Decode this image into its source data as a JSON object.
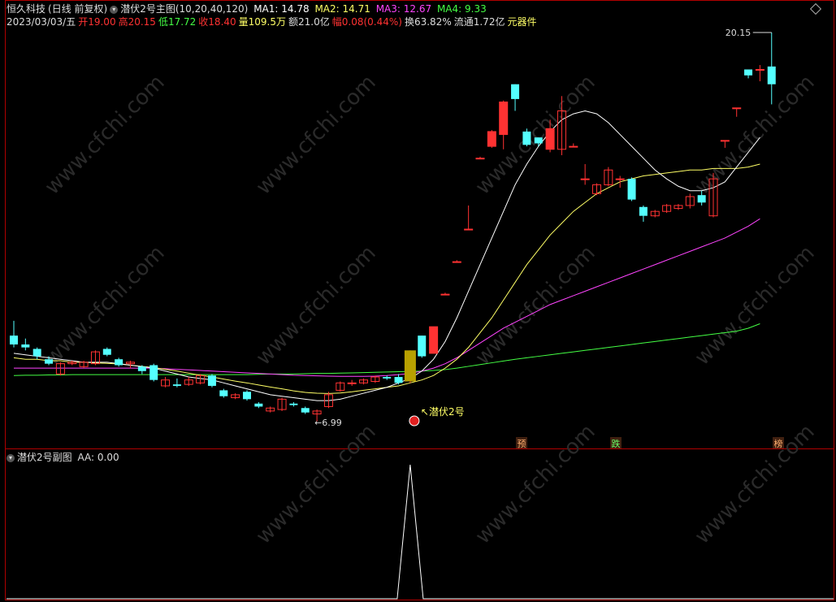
{
  "header": {
    "stock_name": "恒久科技",
    "period": "(日线 前复权)",
    "indicator_name": "潜伏2号主图",
    "params": "(10,20,40,120)",
    "ma1": "MA1: 14.78",
    "ma2": "MA2: 14.71",
    "ma3": "MA3: 12.67",
    "ma4": "MA4: 9.33"
  },
  "quote": {
    "date": "2023/03/03/五",
    "open": "开19.00",
    "high": "高20.15",
    "low": "低17.72",
    "close": "收18.40",
    "volume": "量109.5万",
    "amount": "额21.0亿",
    "change": "幅0.08(0.44%)",
    "turnover": "换63.82%",
    "float": "流通1.72亿",
    "sector": "元器件"
  },
  "sub": {
    "title": "潜伏2号副图",
    "aa": "AA: 0.00"
  },
  "annotations": {
    "max_price": "20.15",
    "min_price": "6.99",
    "signal_label": "潜伏2号",
    "tag_yu": "预",
    "tag_die": "跌",
    "tag_bang": "榜"
  },
  "colors": {
    "up": "#ff3232",
    "down": "#54ffff",
    "ma1": "#ffffff",
    "ma2": "#ffff66",
    "ma3": "#ff44ff",
    "ma4": "#44ff44",
    "border": "#b00000"
  },
  "watermark": "www.cfchi.com",
  "chart_data": {
    "type": "candlestick",
    "title": "潜伏2号主图",
    "price_range": [
      6.99,
      20.15
    ],
    "candles": [
      {
        "o": 9.9,
        "c": 9.6,
        "h": 10.4,
        "l": 9.5
      },
      {
        "o": 9.6,
        "c": 9.5,
        "h": 9.8,
        "l": 9.4
      },
      {
        "o": 9.45,
        "c": 9.2,
        "h": 9.5,
        "l": 9.1
      },
      {
        "o": 9.1,
        "c": 8.95,
        "h": 9.2,
        "l": 8.9
      },
      {
        "o": 8.6,
        "c": 8.95,
        "h": 9.0,
        "l": 8.55
      },
      {
        "o": 8.95,
        "c": 9.0,
        "h": 9.05,
        "l": 8.9
      },
      {
        "o": 8.85,
        "c": 9.0,
        "h": 9.05,
        "l": 8.8
      },
      {
        "o": 8.95,
        "c": 9.35,
        "h": 9.4,
        "l": 8.9
      },
      {
        "o": 9.45,
        "c": 9.25,
        "h": 9.5,
        "l": 9.2
      },
      {
        "o": 9.1,
        "c": 8.9,
        "h": 9.15,
        "l": 8.85
      },
      {
        "o": 8.95,
        "c": 9.0,
        "h": 9.05,
        "l": 8.8
      },
      {
        "o": 8.85,
        "c": 8.7,
        "h": 8.9,
        "l": 8.6
      },
      {
        "o": 8.9,
        "c": 8.4,
        "h": 8.95,
        "l": 8.35
      },
      {
        "o": 8.2,
        "c": 8.4,
        "h": 8.5,
        "l": 8.15
      },
      {
        "o": 8.25,
        "c": 8.2,
        "h": 8.45,
        "l": 8.15
      },
      {
        "o": 8.25,
        "c": 8.4,
        "h": 8.5,
        "l": 8.2
      },
      {
        "o": 8.3,
        "c": 8.55,
        "h": 8.6,
        "l": 8.25
      },
      {
        "o": 8.55,
        "c": 8.2,
        "h": 8.6,
        "l": 8.15
      },
      {
        "o": 8.05,
        "c": 7.85,
        "h": 8.1,
        "l": 7.8
      },
      {
        "o": 7.8,
        "c": 7.9,
        "h": 7.95,
        "l": 7.75
      },
      {
        "o": 8.0,
        "c": 7.75,
        "h": 8.05,
        "l": 7.7
      },
      {
        "o": 7.6,
        "c": 7.5,
        "h": 7.65,
        "l": 7.45
      },
      {
        "o": 7.35,
        "c": 7.45,
        "h": 7.5,
        "l": 7.3
      },
      {
        "o": 7.4,
        "c": 7.75,
        "h": 7.8,
        "l": 7.35
      },
      {
        "o": 7.6,
        "c": 7.55,
        "h": 7.65,
        "l": 7.5
      },
      {
        "o": 7.45,
        "c": 7.3,
        "h": 7.5,
        "l": 7.25
      },
      {
        "o": 7.25,
        "c": 7.35,
        "h": 7.4,
        "l": 6.99
      },
      {
        "o": 7.5,
        "c": 7.9,
        "h": 8.0,
        "l": 7.45
      },
      {
        "o": 8.05,
        "c": 8.3,
        "h": 8.35,
        "l": 8.0
      },
      {
        "o": 8.3,
        "c": 8.3,
        "h": 8.4,
        "l": 8.2
      },
      {
        "o": 8.3,
        "c": 8.4,
        "h": 8.45,
        "l": 8.25
      },
      {
        "o": 8.35,
        "c": 8.5,
        "h": 8.55,
        "l": 8.3
      },
      {
        "o": 8.5,
        "c": 8.45,
        "h": 8.55,
        "l": 8.4
      },
      {
        "o": 8.5,
        "c": 8.3,
        "h": 8.6,
        "l": 8.25
      },
      {
        "o": 8.35,
        "c": 9.4,
        "h": 9.4,
        "l": 8.3
      },
      {
        "o": 9.9,
        "c": 9.2,
        "h": 9.9,
        "l": 9.15
      },
      {
        "o": 9.3,
        "c": 10.2,
        "h": 10.2,
        "l": 9.3
      },
      {
        "o": 11.3,
        "c": 11.3,
        "h": 11.35,
        "l": 11.3
      },
      {
        "o": 12.4,
        "c": 12.4,
        "h": 12.45,
        "l": 12.4
      },
      {
        "o": 13.5,
        "c": 13.5,
        "h": 14.3,
        "l": 13.5
      },
      {
        "o": 15.9,
        "c": 15.9,
        "h": 15.95,
        "l": 15.9
      },
      {
        "o": 16.3,
        "c": 16.8,
        "h": 16.85,
        "l": 16.25
      },
      {
        "o": 16.7,
        "c": 17.8,
        "h": 17.85,
        "l": 16.2
      },
      {
        "o": 18.4,
        "c": 17.9,
        "h": 18.4,
        "l": 17.5
      },
      {
        "o": 16.8,
        "c": 16.35,
        "h": 16.9,
        "l": 16.3
      },
      {
        "o": 16.6,
        "c": 16.4,
        "h": 16.6,
        "l": 16.3
      },
      {
        "o": 16.2,
        "c": 16.9,
        "h": 17.2,
        "l": 16.1
      },
      {
        "o": 16.2,
        "c": 17.5,
        "h": 18.0,
        "l": 16.0
      },
      {
        "o": 16.3,
        "c": 16.3,
        "h": 16.4,
        "l": 16.3
      },
      {
        "o": 15.2,
        "c": 15.2,
        "h": 15.7,
        "l": 15.0
      },
      {
        "o": 14.7,
        "c": 15.0,
        "h": 15.05,
        "l": 14.65
      },
      {
        "o": 15.0,
        "c": 15.5,
        "h": 15.6,
        "l": 14.95
      },
      {
        "o": 15.2,
        "c": 15.2,
        "h": 15.3,
        "l": 14.9
      },
      {
        "o": 15.2,
        "c": 14.5,
        "h": 15.25,
        "l": 14.45
      },
      {
        "o": 14.25,
        "c": 13.95,
        "h": 14.3,
        "l": 13.75
      },
      {
        "o": 13.95,
        "c": 14.1,
        "h": 14.15,
        "l": 13.9
      },
      {
        "o": 14.1,
        "c": 14.3,
        "h": 14.35,
        "l": 14.05
      },
      {
        "o": 14.2,
        "c": 14.3,
        "h": 14.35,
        "l": 14.15
      },
      {
        "o": 14.3,
        "c": 14.6,
        "h": 14.7,
        "l": 14.2
      },
      {
        "o": 14.65,
        "c": 14.4,
        "h": 14.8,
        "l": 14.3
      },
      {
        "o": 13.95,
        "c": 15.2,
        "h": 15.4,
        "l": 13.9
      },
      {
        "o": 16.5,
        "c": 16.5,
        "h": 16.5,
        "l": 16.25
      },
      {
        "o": 17.6,
        "c": 17.6,
        "h": 17.6,
        "l": 17.3
      },
      {
        "o": 18.9,
        "c": 18.7,
        "h": 18.9,
        "l": 18.6
      },
      {
        "o": 18.9,
        "c": 18.9,
        "h": 19.05,
        "l": 18.5
      },
      {
        "o": 19.0,
        "c": 18.4,
        "h": 20.15,
        "l": 17.72
      }
    ],
    "ma1": [
      9.3,
      9.25,
      9.2,
      9.15,
      9.1,
      9.05,
      9.0,
      9.0,
      9.0,
      8.95,
      8.9,
      8.85,
      8.8,
      8.7,
      8.6,
      8.5,
      8.45,
      8.4,
      8.3,
      8.2,
      8.1,
      8.0,
      7.9,
      7.85,
      7.8,
      7.75,
      7.7,
      7.7,
      7.75,
      7.85,
      7.95,
      8.05,
      8.15,
      8.3,
      8.45,
      8.7,
      9.1,
      9.7,
      10.5,
      11.4,
      12.3,
      13.2,
      14.1,
      15.0,
      15.7,
      16.3,
      16.8,
      17.2,
      17.4,
      17.5,
      17.4,
      17.1,
      16.7,
      16.3,
      15.9,
      15.5,
      15.2,
      14.95,
      14.8,
      14.8,
      14.9,
      15.1,
      15.6,
      16.1,
      16.6
    ],
    "ma2": [
      9.15,
      9.1,
      9.1,
      9.05,
      9.05,
      9.0,
      9.0,
      8.98,
      8.96,
      8.94,
      8.9,
      8.86,
      8.82,
      8.76,
      8.7,
      8.63,
      8.56,
      8.5,
      8.43,
      8.36,
      8.3,
      8.23,
      8.16,
      8.1,
      8.03,
      7.98,
      7.95,
      7.94,
      7.96,
      8.0,
      8.05,
      8.1,
      8.15,
      8.2,
      8.3,
      8.4,
      8.55,
      8.8,
      9.1,
      9.5,
      10.0,
      10.5,
      11.1,
      11.7,
      12.3,
      12.8,
      13.3,
      13.7,
      14.1,
      14.4,
      14.7,
      14.9,
      15.1,
      15.2,
      15.3,
      15.35,
      15.4,
      15.45,
      15.5,
      15.5,
      15.55,
      15.55,
      15.55,
      15.6,
      15.7
    ],
    "ma3": [
      8.8,
      8.8,
      8.8,
      8.8,
      8.8,
      8.8,
      8.8,
      8.8,
      8.8,
      8.8,
      8.8,
      8.8,
      8.8,
      8.78,
      8.76,
      8.74,
      8.72,
      8.7,
      8.68,
      8.66,
      8.64,
      8.62,
      8.6,
      8.58,
      8.56,
      8.55,
      8.54,
      8.53,
      8.52,
      8.52,
      8.52,
      8.53,
      8.55,
      8.58,
      8.62,
      8.7,
      8.8,
      8.95,
      9.15,
      9.4,
      9.65,
      9.9,
      10.15,
      10.35,
      10.55,
      10.75,
      10.95,
      11.1,
      11.25,
      11.4,
      11.55,
      11.7,
      11.85,
      12.0,
      12.15,
      12.3,
      12.45,
      12.6,
      12.75,
      12.9,
      13.05,
      13.2,
      13.4,
      13.6,
      13.85
    ],
    "ma4": [
      8.55,
      8.56,
      8.56,
      8.57,
      8.57,
      8.58,
      8.58,
      8.58,
      8.58,
      8.58,
      8.58,
      8.58,
      8.58,
      8.58,
      8.58,
      8.58,
      8.58,
      8.58,
      8.58,
      8.58,
      8.58,
      8.59,
      8.6,
      8.6,
      8.6,
      8.61,
      8.62,
      8.62,
      8.63,
      8.64,
      8.65,
      8.66,
      8.67,
      8.68,
      8.69,
      8.7,
      8.72,
      8.75,
      8.8,
      8.86,
      8.92,
      8.98,
      9.04,
      9.1,
      9.15,
      9.2,
      9.25,
      9.3,
      9.35,
      9.4,
      9.45,
      9.5,
      9.55,
      9.6,
      9.65,
      9.7,
      9.75,
      9.8,
      9.85,
      9.9,
      9.95,
      10.0,
      10.05,
      10.15,
      10.3
    ],
    "signal_index": 34,
    "aa_values_nonzero": {
      "index": 34,
      "value": 1
    }
  }
}
